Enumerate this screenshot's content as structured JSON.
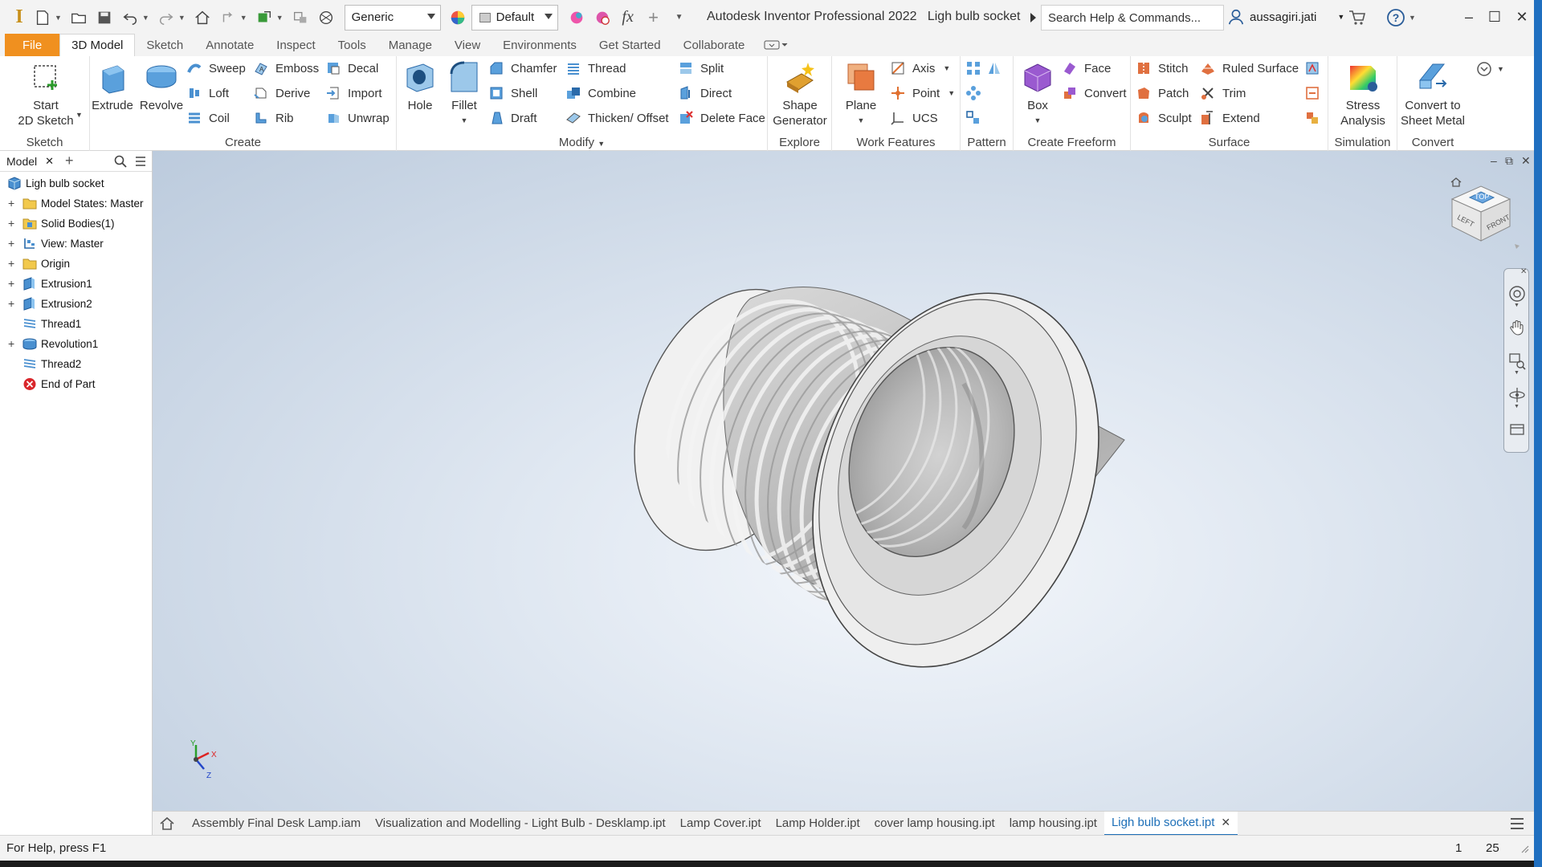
{
  "titlebar": {
    "app_title": "Autodesk Inventor Professional 2022",
    "document_title": "Ligh bulb socket",
    "material_combo": "Generic",
    "appearance_combo": "Default",
    "search_placeholder": "Search Help & Commands...",
    "user_name": "aussagiri.jati"
  },
  "tabs": [
    {
      "label": "File"
    },
    {
      "label": "3D Model"
    },
    {
      "label": "Sketch"
    },
    {
      "label": "Annotate"
    },
    {
      "label": "Inspect"
    },
    {
      "label": "Tools"
    },
    {
      "label": "Manage"
    },
    {
      "label": "View"
    },
    {
      "label": "Environments"
    },
    {
      "label": "Get Started"
    },
    {
      "label": "Collaborate"
    }
  ],
  "ribbon": {
    "sketch": {
      "title": "Sketch",
      "start_2d_sketch_l1": "Start",
      "start_2d_sketch_l2": "2D Sketch"
    },
    "create": {
      "title": "Create",
      "extrude": "Extrude",
      "revolve": "Revolve",
      "sweep": "Sweep",
      "loft": "Loft",
      "coil": "Coil",
      "emboss": "Emboss",
      "derive": "Derive",
      "rib": "Rib",
      "decal": "Decal",
      "import": "Import",
      "unwrap": "Unwrap"
    },
    "modify": {
      "title": "Modify",
      "hole": "Hole",
      "fillet": "Fillet",
      "chamfer": "Chamfer",
      "shell": "Shell",
      "draft": "Draft",
      "thread": "Thread",
      "combine": "Combine",
      "thicken": "Thicken/ Offset",
      "split": "Split",
      "direct": "Direct",
      "delete_face": "Delete Face"
    },
    "explore": {
      "title": "Explore",
      "shape_gen_l1": "Shape",
      "shape_gen_l2": "Generator"
    },
    "work_features": {
      "title": "Work Features",
      "plane": "Plane",
      "axis": "Axis",
      "point": "Point",
      "ucs": "UCS"
    },
    "pattern": {
      "title": "Pattern"
    },
    "create_freeform": {
      "title": "Create Freeform",
      "box": "Box",
      "face": "Face",
      "convert": "Convert"
    },
    "surface": {
      "title": "Surface",
      "stitch": "Stitch",
      "patch": "Patch",
      "sculpt": "Sculpt",
      "ruled_surface": "Ruled Surface",
      "trim": "Trim",
      "extend": "Extend"
    },
    "simulation": {
      "title": "Simulation",
      "stress_l1": "Stress",
      "stress_l2": "Analysis"
    },
    "convert": {
      "title": "Convert",
      "sheet_l1": "Convert to",
      "sheet_l2": "Sheet Metal"
    }
  },
  "browser": {
    "tab_label": "Model",
    "items": [
      {
        "label": "Ligh bulb socket"
      },
      {
        "label": "Model States: Master"
      },
      {
        "label": "Solid Bodies(1)"
      },
      {
        "label": "View: Master"
      },
      {
        "label": "Origin"
      },
      {
        "label": "Extrusion1"
      },
      {
        "label": "Extrusion2"
      },
      {
        "label": "Thread1"
      },
      {
        "label": "Revolution1"
      },
      {
        "label": "Thread2"
      },
      {
        "label": "End of Part"
      }
    ]
  },
  "viewcube": {
    "top": "TOP",
    "left": "LEFT",
    "front": "FRONT"
  },
  "triad": {
    "x": "X",
    "y": "Y",
    "z": "Z"
  },
  "doc_tabs": [
    {
      "label": "Assembly Final Desk Lamp.iam"
    },
    {
      "label": "Visualization and Modelling - Light Bulb - Desklamp.ipt"
    },
    {
      "label": "Lamp Cover.ipt"
    },
    {
      "label": "Lamp Holder.ipt"
    },
    {
      "label": "cover lamp housing.ipt"
    },
    {
      "label": "lamp housing.ipt"
    },
    {
      "label": "Ligh bulb socket.ipt"
    }
  ],
  "status": {
    "help": "For Help, press F1",
    "count1": "1",
    "count2": "25"
  },
  "colors": {
    "file_tab": "#f0901f",
    "accent": "#1d6fb8",
    "viewport_top": "#bccbdd",
    "viewport_center": "#f4f7fb"
  }
}
